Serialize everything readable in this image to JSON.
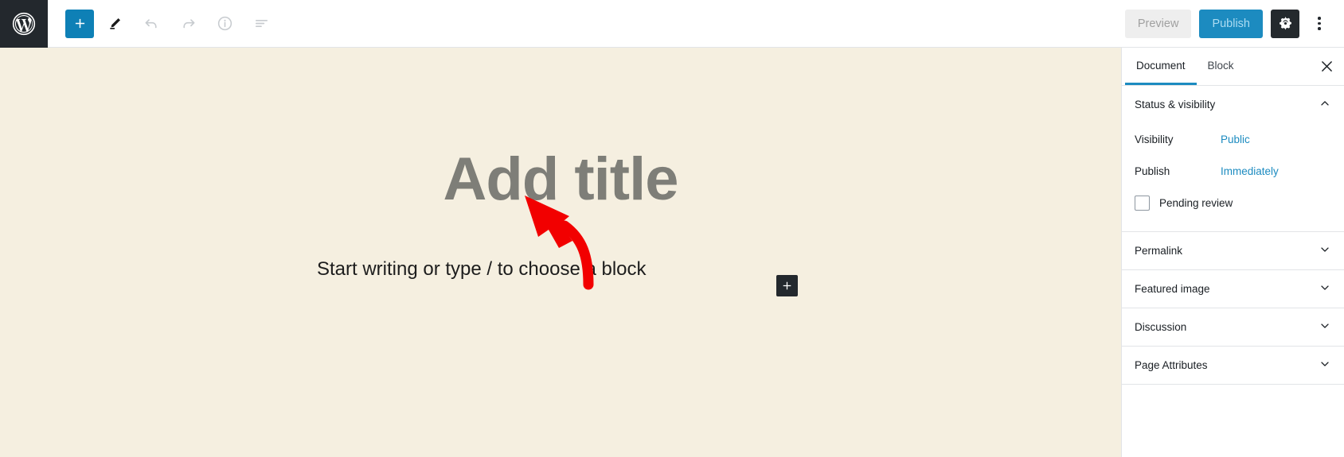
{
  "header": {
    "logo_icon": "wordpress-logo-icon",
    "tools": [
      {
        "name": "add-block-button",
        "icon": "plus-icon",
        "style": "primary"
      },
      {
        "name": "edit-mode-button",
        "icon": "pencil-icon",
        "style": "plain"
      },
      {
        "name": "undo-button",
        "icon": "undo-arrow-icon",
        "style": "plain-disabled"
      },
      {
        "name": "redo-button",
        "icon": "redo-arrow-icon",
        "style": "plain-disabled"
      },
      {
        "name": "content-info-button",
        "icon": "info-circle-icon",
        "style": "plain-disabled"
      },
      {
        "name": "block-navigation-button",
        "icon": "list-view-icon",
        "style": "plain"
      }
    ],
    "preview_label": "Preview",
    "publish_label": "Publish",
    "settings_icon": "gear-icon",
    "more_menu_icon": "kebab-menu-icon"
  },
  "canvas": {
    "title_placeholder": "Add title",
    "paragraph_placeholder": "Start writing or type / to choose a block",
    "inserter_icon": "plus-icon",
    "annotation": {
      "type": "curved-arrow",
      "color": "#f20000",
      "points_to": "Add title"
    },
    "background_color": "#f5efe0"
  },
  "sidebar": {
    "tabs": [
      {
        "label": "Document",
        "active": true
      },
      {
        "label": "Block",
        "active": false
      }
    ],
    "close_icon": "close-x-icon",
    "panels": [
      {
        "title": "Status & visibility",
        "expanded": true,
        "chevron_icon": "chevron-up-icon",
        "rows": [
          {
            "label": "Visibility",
            "value": "Public"
          },
          {
            "label": "Publish",
            "value": "Immediately"
          }
        ],
        "checkbox": {
          "label": "Pending review",
          "checked": false
        }
      },
      {
        "title": "Permalink",
        "expanded": false,
        "chevron_icon": "chevron-down-icon"
      },
      {
        "title": "Featured image",
        "expanded": false,
        "chevron_icon": "chevron-down-icon"
      },
      {
        "title": "Discussion",
        "expanded": false,
        "chevron_icon": "chevron-down-icon"
      },
      {
        "title": "Page Attributes",
        "expanded": false,
        "chevron_icon": "chevron-down-icon"
      }
    ]
  },
  "colors": {
    "accent_blue": "#1c8bc0",
    "dark_chrome": "#23282d",
    "canvas_cream": "#f5efe0",
    "annotation_red": "#f20000"
  }
}
